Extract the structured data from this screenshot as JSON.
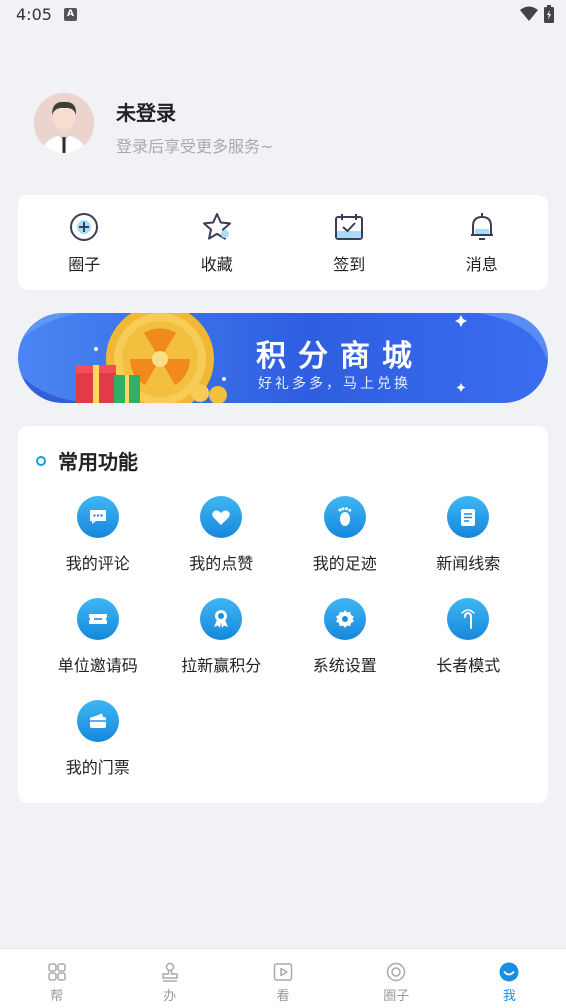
{
  "status_bar": {
    "time": "4:05",
    "notification_badge": "A"
  },
  "profile": {
    "name": "未登录",
    "subtitle": "登录后享受更多服务~"
  },
  "quick_actions": [
    {
      "label": "圈子",
      "icon": "plus-circle-icon"
    },
    {
      "label": "收藏",
      "icon": "star-icon"
    },
    {
      "label": "签到",
      "icon": "calendar-check-icon"
    },
    {
      "label": "消息",
      "icon": "bell-icon"
    }
  ],
  "banner": {
    "title": "积分商城",
    "subtitle": "好礼多多，马上兑换"
  },
  "functions": {
    "title": "常用功能",
    "items": [
      {
        "label": "我的评论",
        "icon": "comment-icon"
      },
      {
        "label": "我的点赞",
        "icon": "heart-icon"
      },
      {
        "label": "我的足迹",
        "icon": "footprint-icon"
      },
      {
        "label": "新闻线索",
        "icon": "document-icon"
      },
      {
        "label": "单位邀请码",
        "icon": "ticket-icon"
      },
      {
        "label": "拉新赢积分",
        "icon": "award-icon"
      },
      {
        "label": "系统设置",
        "icon": "gear-icon"
      },
      {
        "label": "长者模式",
        "icon": "cane-icon"
      },
      {
        "label": "我的门票",
        "icon": "wallet-icon"
      }
    ]
  },
  "tabbar": {
    "items": [
      {
        "label": "帮",
        "icon": "grid-icon"
      },
      {
        "label": "办",
        "icon": "stamp-icon"
      },
      {
        "label": "看",
        "icon": "play-icon"
      },
      {
        "label": "圈子",
        "icon": "target-icon"
      },
      {
        "label": "我",
        "icon": "profile-smile-icon"
      }
    ],
    "active_index": 4
  },
  "colors": {
    "accent": "#1a8fe0",
    "background": "#f1f2f5",
    "banner_blue": "#2f5ee0"
  }
}
